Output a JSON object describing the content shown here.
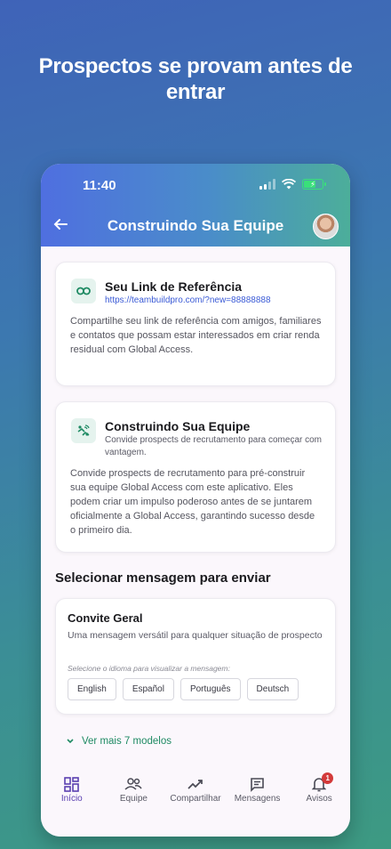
{
  "headline": "Prospectos se provam antes de entrar",
  "status": {
    "time": "11:40"
  },
  "appbar": {
    "title": "Construindo Sua Equipe",
    "back_icon": "arrow-left-icon"
  },
  "referral_card": {
    "title": "Seu Link de Referência",
    "link": "https://teambuildpro.com/?new=88888888",
    "body": "Compartilhe seu link de referência com amigos, familiares e contatos que possam estar interessados em criar renda residual com Global Access.",
    "icon": "link-icon"
  },
  "team_card": {
    "title": "Construindo Sua Equipe",
    "subtitle": "Convide prospects de recrutamento para começar com vantagem.",
    "body": "Convide prospects de recrutamento para pré-construir sua equipe Global Access com este aplicativo. Eles podem criar um impulso poderoso antes de se juntarem oficialmente a Global Access, garantindo sucesso desde o primeiro dia.",
    "icon": "connect-without-contact-icon"
  },
  "section_title": "Selecionar mensagem para enviar",
  "message_card": {
    "title": "Convite Geral",
    "description": "Uma mensagem versátil para qualquer situação de prospecto",
    "language_hint": "Selecione o idioma para visualizar a mensagem:",
    "languages": [
      "English",
      "Español",
      "Português",
      "Deutsch"
    ]
  },
  "see_more": "Ver mais 7 modelos",
  "nav": [
    {
      "label": "Início",
      "icon": "dashboard-icon",
      "active": true
    },
    {
      "label": "Equipe",
      "icon": "people-icon"
    },
    {
      "label": "Compartilhar",
      "icon": "trending-up-icon"
    },
    {
      "label": "Mensagens",
      "icon": "message-icon"
    },
    {
      "label": "Avisos",
      "icon": "bell-icon",
      "badge": "1"
    }
  ],
  "colors": {
    "accent": "#1e8a63",
    "link": "#3b5bd6",
    "nav_active": "#5a3fb0",
    "badge": "#d33a3a"
  }
}
